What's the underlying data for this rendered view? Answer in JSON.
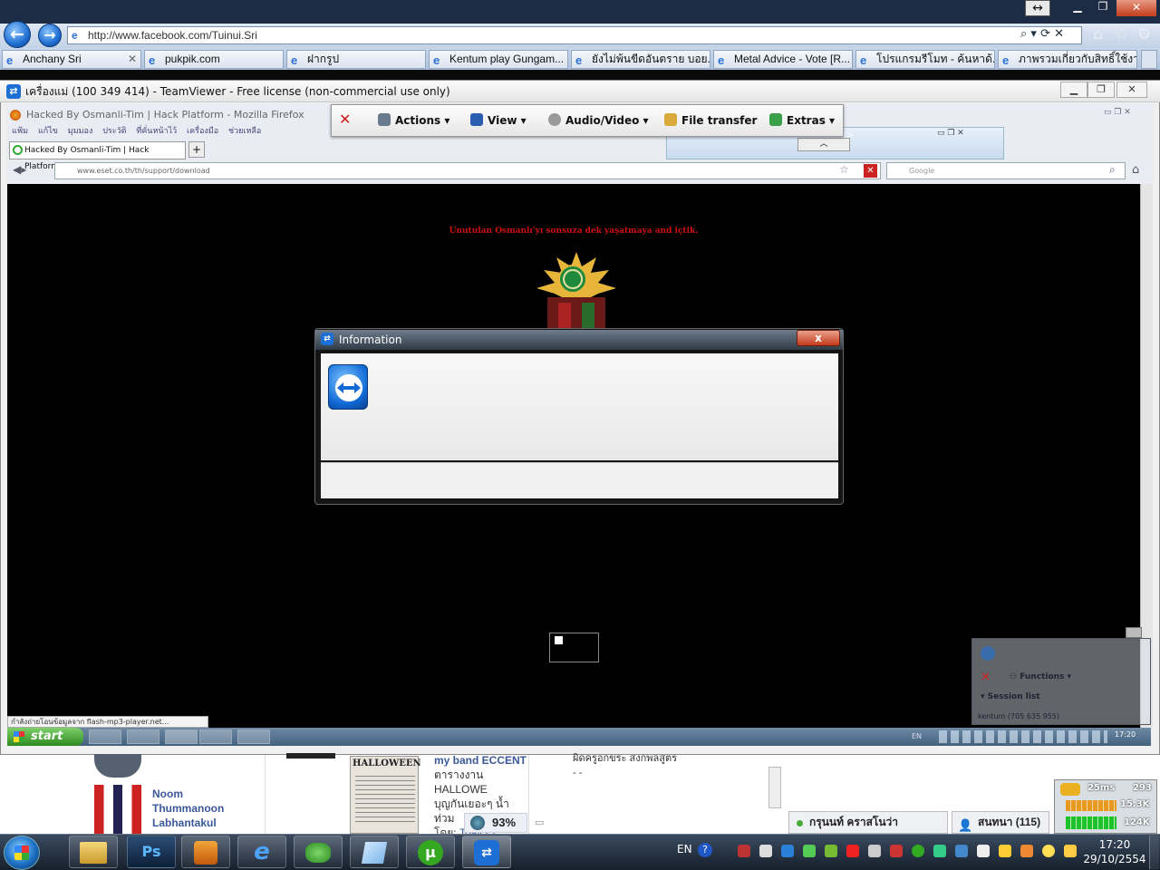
{
  "ie": {
    "address": "http://www.facebook.com/Tuinui.Sri",
    "tabs": [
      {
        "label": "Anchany Sri"
      },
      {
        "label": "pukpik.com"
      },
      {
        "label": "ฝากรูป"
      },
      {
        "label": "Kentum play Gungam..."
      },
      {
        "label": "ยังไม่พ้นขีดอันตราย บอย..."
      },
      {
        "label": "Metal Advice - Vote [R..."
      },
      {
        "label": "โปรแกรมรีโมท - ค้นหาด้..."
      },
      {
        "label": "ภาพรวมเกี่ยวกับสิทธิ์ใช้งาน"
      }
    ]
  },
  "teamviewer": {
    "title": "เครื่องแม่ (100 349 414) - TeamViewer - Free license (non-commercial use only)",
    "toolbar": {
      "actions": "Actions",
      "view": "View",
      "audio_video": "Audio/Video",
      "file_transfer": "File transfer",
      "extras": "Extras"
    },
    "hidden_tab_text": "m>"
  },
  "firefox": {
    "title": "Hacked By Osmanli-Tim | Hack Platform - Mozilla Firefox",
    "menu": "แฟ้ม แก้ไข มุมมอง ประวัติ ที่คั่นหน้าไว้ เครื่องมือ ช่วยเหลือ",
    "tab": "Hacked By Osmanli-Tim | Hack Platform",
    "url": "www.eset.co.th/th/support/download",
    "search_placeholder": "Google",
    "status": "กำลังถ่ายโอนข้อมูลจาก flash-mp3-player.net..."
  },
  "page": {
    "hack_text": "Unutulan Osmanlı'yı sonsuza dek yaşatmaya and içtik."
  },
  "info_dialog": {
    "title": "Information",
    "close": "x"
  },
  "remote": {
    "start": "start",
    "lang": "EN",
    "clock": "17:20",
    "session": {
      "functions": "Functions",
      "session_list": "Session list",
      "entry": "kentum (705 635 955)"
    }
  },
  "facebook": {
    "friend_name": "Noom Thummanoon Labhantakul",
    "halloween": "HALLOWEEN",
    "post_title": "my band ECCENT",
    "post_line1": "ตารางงาน HALLOWE",
    "post_line2": "บุญกันเยอะๆ น้ำท่วม",
    "post_by": "โดย:",
    "post_author": "Toay Et",
    "percent": "93%",
    "comment": "ผิดครูอกขระ สงกพลสูตร",
    "comment2": "- -",
    "chat1": "กรุนนท์ คราสโนว่า",
    "chat2": "สนทนา (115)"
  },
  "net_meter": {
    "ping": "25ms",
    "val1": "293",
    "val2": "15.3K",
    "val3": "124K"
  },
  "taskbar": {
    "lang": "EN",
    "time": "17:20",
    "date": "29/10/2554",
    "ps": "Ps"
  }
}
